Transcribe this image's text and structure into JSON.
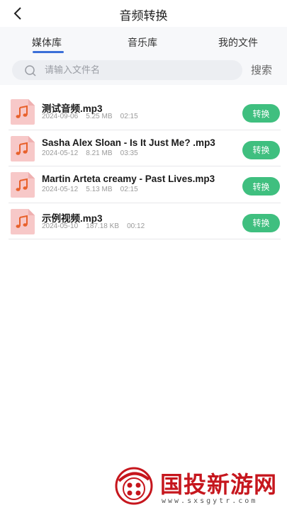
{
  "header": {
    "title": "音频转换",
    "back_icon": "chevron-left-icon"
  },
  "tabs": [
    {
      "label": "媒体库",
      "active": true
    },
    {
      "label": "音乐库",
      "active": false
    },
    {
      "label": "我的文件",
      "active": false
    }
  ],
  "search": {
    "placeholder": "请输入文件名",
    "value": "",
    "button_label": "搜索"
  },
  "files": [
    {
      "name": "测试音频.mp3",
      "date": "2024-09-06",
      "size": "5.25 MB",
      "duration": "02:15",
      "action": "转换"
    },
    {
      "name": "Sasha Alex Sloan - Is It Just Me?  .mp3",
      "date": "2024-05-12",
      "size": "8.21 MB",
      "duration": "03:35",
      "action": "转换"
    },
    {
      "name": "Martin Arteta creamy - Past Lives.mp3",
      "date": "2024-05-12",
      "size": "5.13 MB",
      "duration": "02:15",
      "action": "转换"
    },
    {
      "name": "示例视频.mp3",
      "date": "2024-05-10",
      "size": "187.18 KB",
      "duration": "00:12",
      "action": "转换"
    }
  ],
  "watermark": {
    "text": "国投新游网",
    "url": "www.sxsgytr.com"
  },
  "colors": {
    "accent": "#3b6fd8",
    "convert_button": "#3fbf7f",
    "file_icon_bg": "#f7c8c8",
    "file_icon_note": "#e8612c",
    "watermark": "#c6161d"
  }
}
